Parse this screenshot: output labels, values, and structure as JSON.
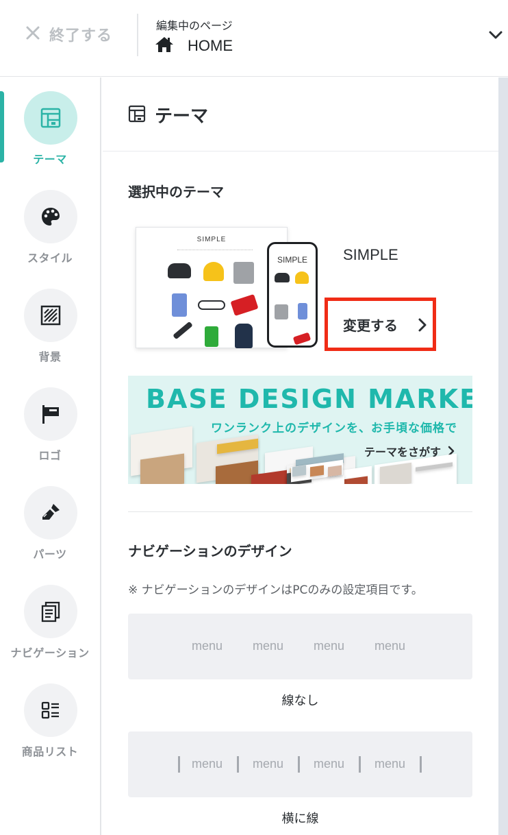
{
  "header": {
    "exit_label": "終了する",
    "page_caption": "編集中のページ",
    "page_name": "HOME"
  },
  "sidebar": {
    "items": [
      {
        "label": "テーマ",
        "icon": "layout-icon",
        "active": true
      },
      {
        "label": "スタイル",
        "icon": "palette-icon"
      },
      {
        "label": "背景",
        "icon": "pattern-icon"
      },
      {
        "label": "ロゴ",
        "icon": "signboard-icon"
      },
      {
        "label": "パーツ",
        "icon": "brush-icon"
      },
      {
        "label": "ナビゲーション",
        "icon": "documents-icon"
      },
      {
        "label": "商品リスト",
        "icon": "list-icon"
      }
    ]
  },
  "main": {
    "title": "テーマ",
    "selected_heading": "選択中のテーマ",
    "theme": {
      "name": "SIMPLE",
      "preview_desktop_title": "SIMPLE",
      "preview_phone_title": "SIMPLE",
      "change_label": "変更する"
    },
    "market_banner": {
      "title": "BASE DESIGN MARKET",
      "tagline": "ワンランク上のデザインを、お手頃な価格で",
      "link": "テーマをさがす"
    },
    "nav_design": {
      "heading": "ナビゲーションのデザイン",
      "note": "※ ナビゲーションのデザインはPCのみの設定項目です。",
      "options": [
        {
          "caption": "線なし",
          "menus": [
            "menu",
            "menu",
            "menu",
            "menu"
          ]
        },
        {
          "caption": "横に線",
          "menus": [
            "menu",
            "menu",
            "menu",
            "menu"
          ]
        }
      ]
    }
  },
  "colors": {
    "accent": "#2bb3a6",
    "highlight_border": "#f02c16",
    "market_teal": "#1fb8ac"
  }
}
